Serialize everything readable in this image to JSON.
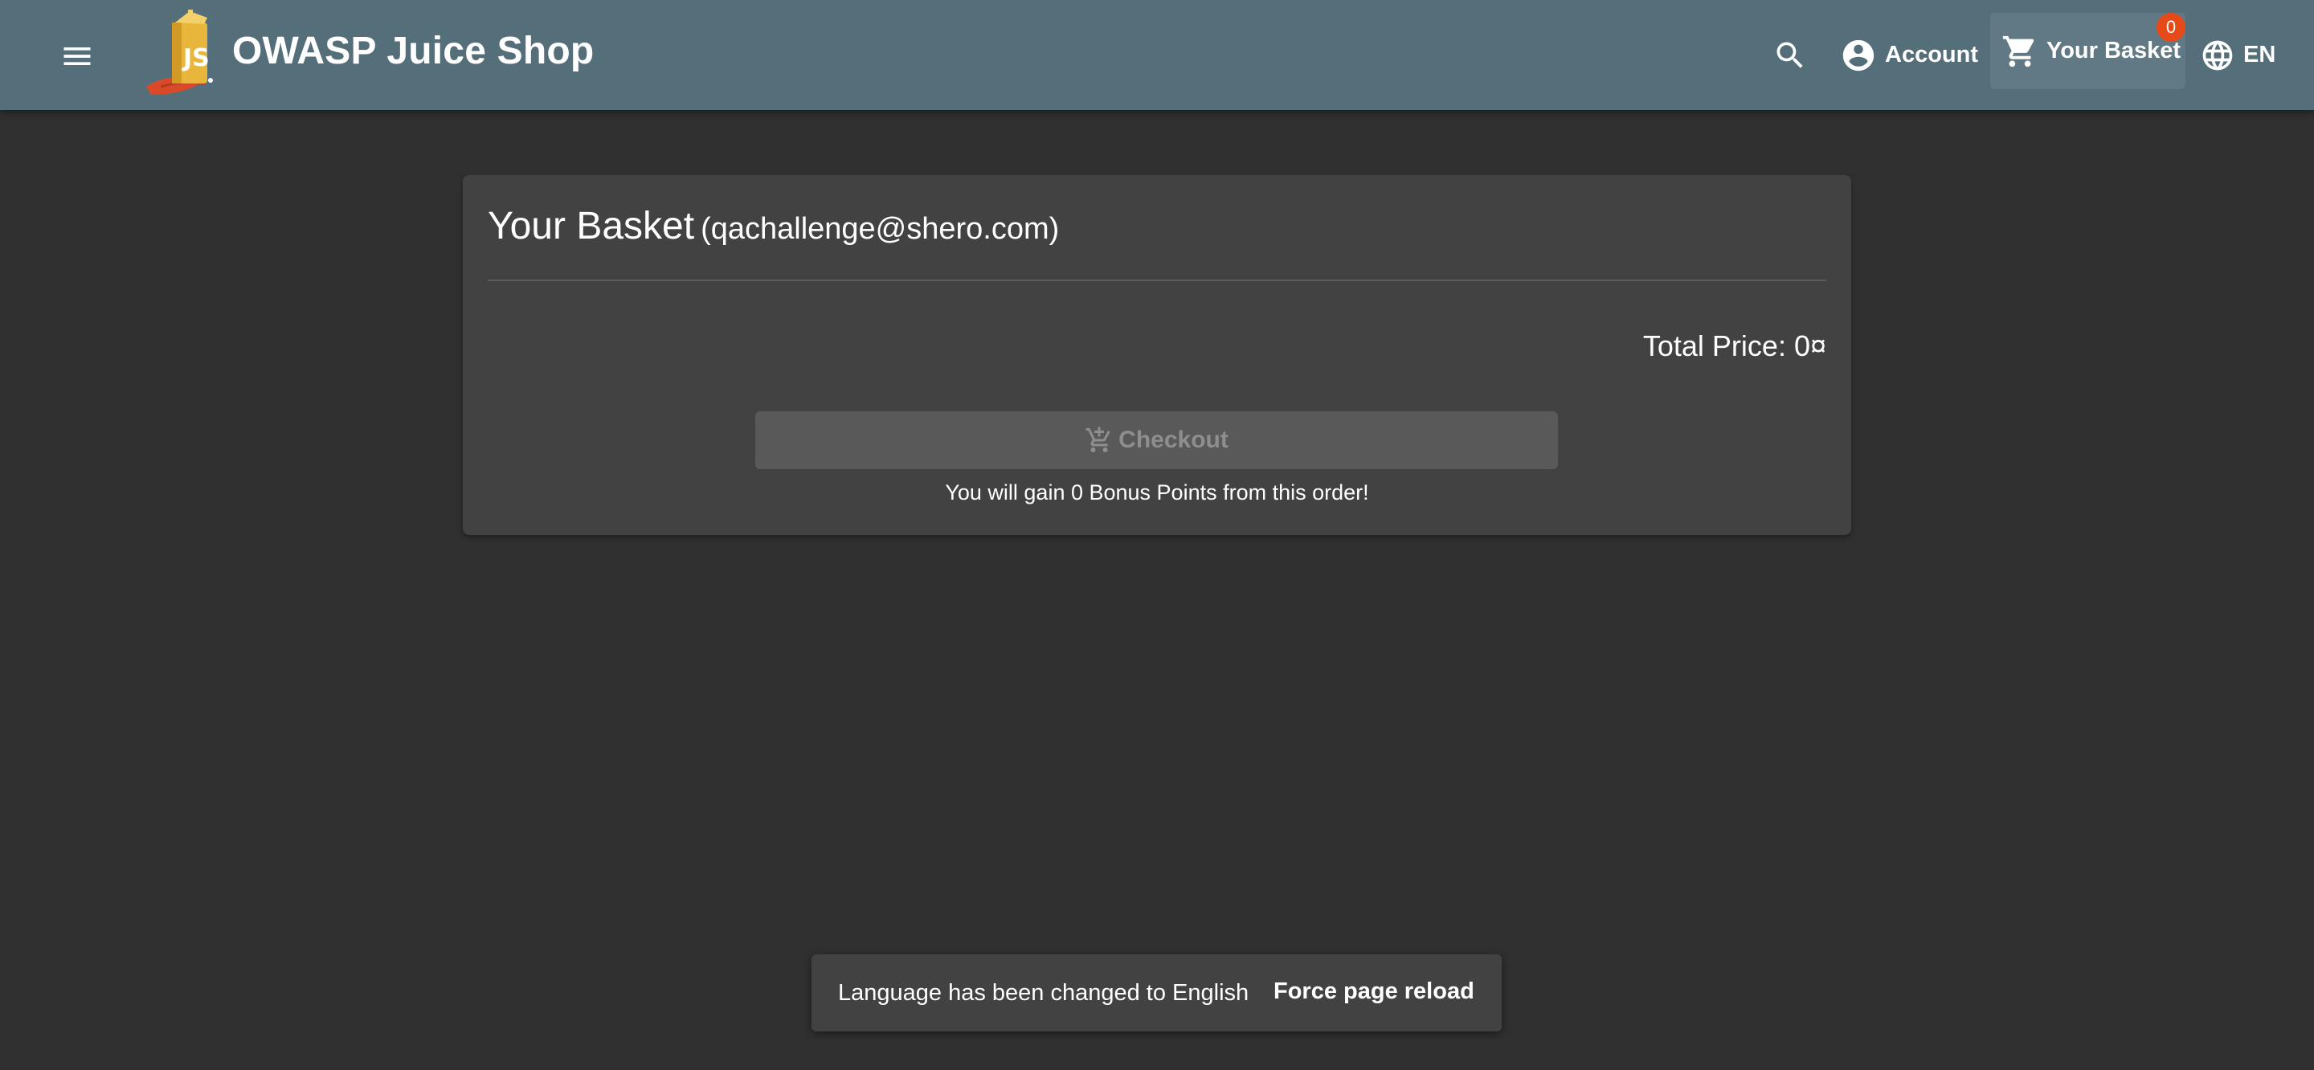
{
  "header": {
    "app_title": "OWASP Juice Shop",
    "account_label": "Account",
    "basket_label": "Your Basket",
    "basket_badge": "0",
    "language_label": "EN",
    "icons": [
      "menu-icon",
      "juice-shop-logo",
      "search-icon",
      "account-circle-icon",
      "shopping-cart-icon",
      "language-icon"
    ]
  },
  "basket": {
    "title": "Your Basket",
    "email": "(qachallenge@shero.com)",
    "total_price": "Total Price: 0¤",
    "checkout_label": "Checkout",
    "checkout_enabled": false,
    "bonus_text": "You will gain 0 Bonus Points from this order!"
  },
  "snackbar": {
    "message": "Language has been changed to English",
    "action_label": "Force page reload"
  },
  "colors": {
    "toolbar": "#546e7a",
    "background": "#303030",
    "card": "#424242",
    "badge": "#e64a19"
  }
}
